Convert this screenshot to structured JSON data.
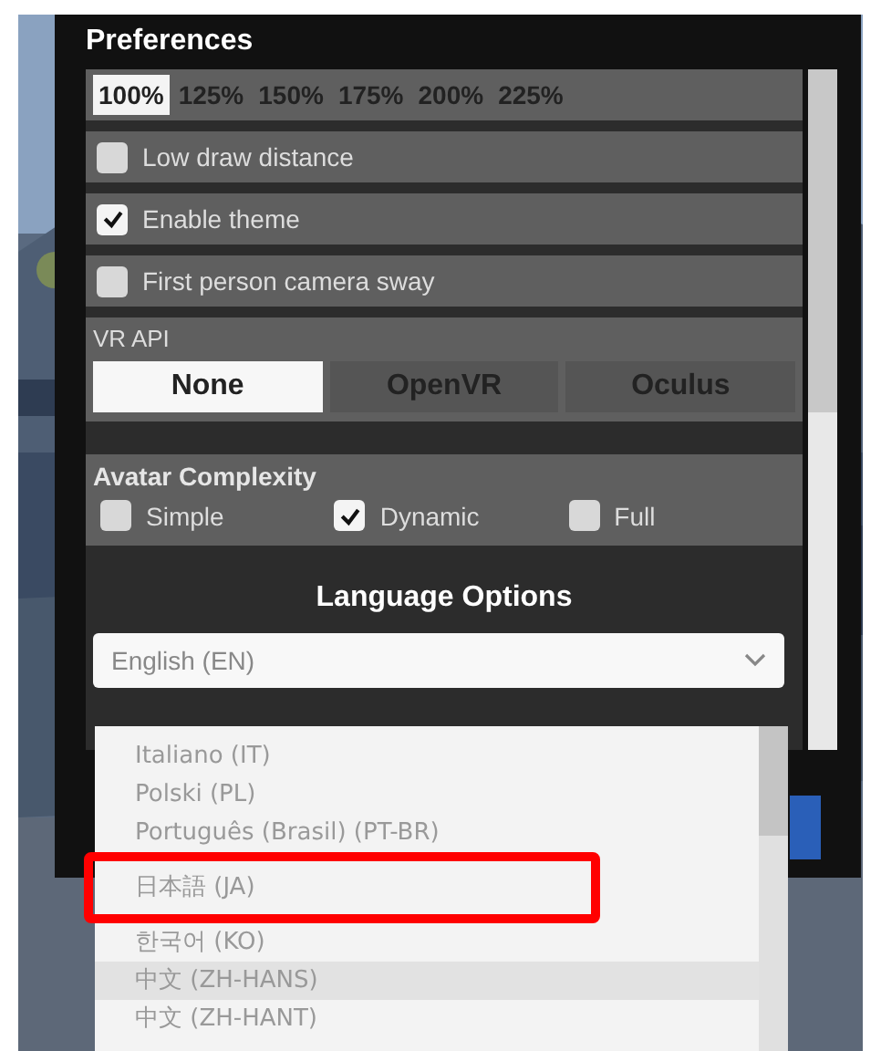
{
  "window": {
    "title": "Preferences"
  },
  "scale_options": [
    {
      "label": "100%",
      "selected": true
    },
    {
      "label": "125%",
      "selected": false
    },
    {
      "label": "150%",
      "selected": false
    },
    {
      "label": "175%",
      "selected": false
    },
    {
      "label": "200%",
      "selected": false
    },
    {
      "label": "225%",
      "selected": false
    }
  ],
  "toggles": [
    {
      "label": "Low draw distance",
      "checked": false
    },
    {
      "label": "Enable theme",
      "checked": true
    },
    {
      "label": "First person camera sway",
      "checked": false
    }
  ],
  "vr_api": {
    "label": "VR API",
    "options": [
      {
        "label": "None",
        "selected": true
      },
      {
        "label": "OpenVR",
        "selected": false
      },
      {
        "label": "Oculus",
        "selected": false
      }
    ]
  },
  "avatar_complexity": {
    "label": "Avatar Complexity",
    "options": [
      {
        "label": "Simple",
        "checked": false
      },
      {
        "label": "Dynamic",
        "checked": true
      },
      {
        "label": "Full",
        "checked": false
      }
    ]
  },
  "language": {
    "heading": "Language Options",
    "value": "English (EN)",
    "options": [
      {
        "label": "Italiano (IT)",
        "highlighted": false,
        "marked": false
      },
      {
        "label": "Polski (PL)",
        "highlighted": false,
        "marked": false
      },
      {
        "label": "Português (Brasil) (PT-BR)",
        "highlighted": false,
        "marked": false
      },
      {
        "label": "日本語 (JA)",
        "highlighted": false,
        "marked": true
      },
      {
        "label": "한국어 (KO)",
        "highlighted": false,
        "marked": false
      },
      {
        "label": "中文 (ZH-HANS)",
        "highlighted": true,
        "marked": false
      },
      {
        "label": "中文 (ZH-HANT)",
        "highlighted": false,
        "marked": false
      }
    ]
  }
}
